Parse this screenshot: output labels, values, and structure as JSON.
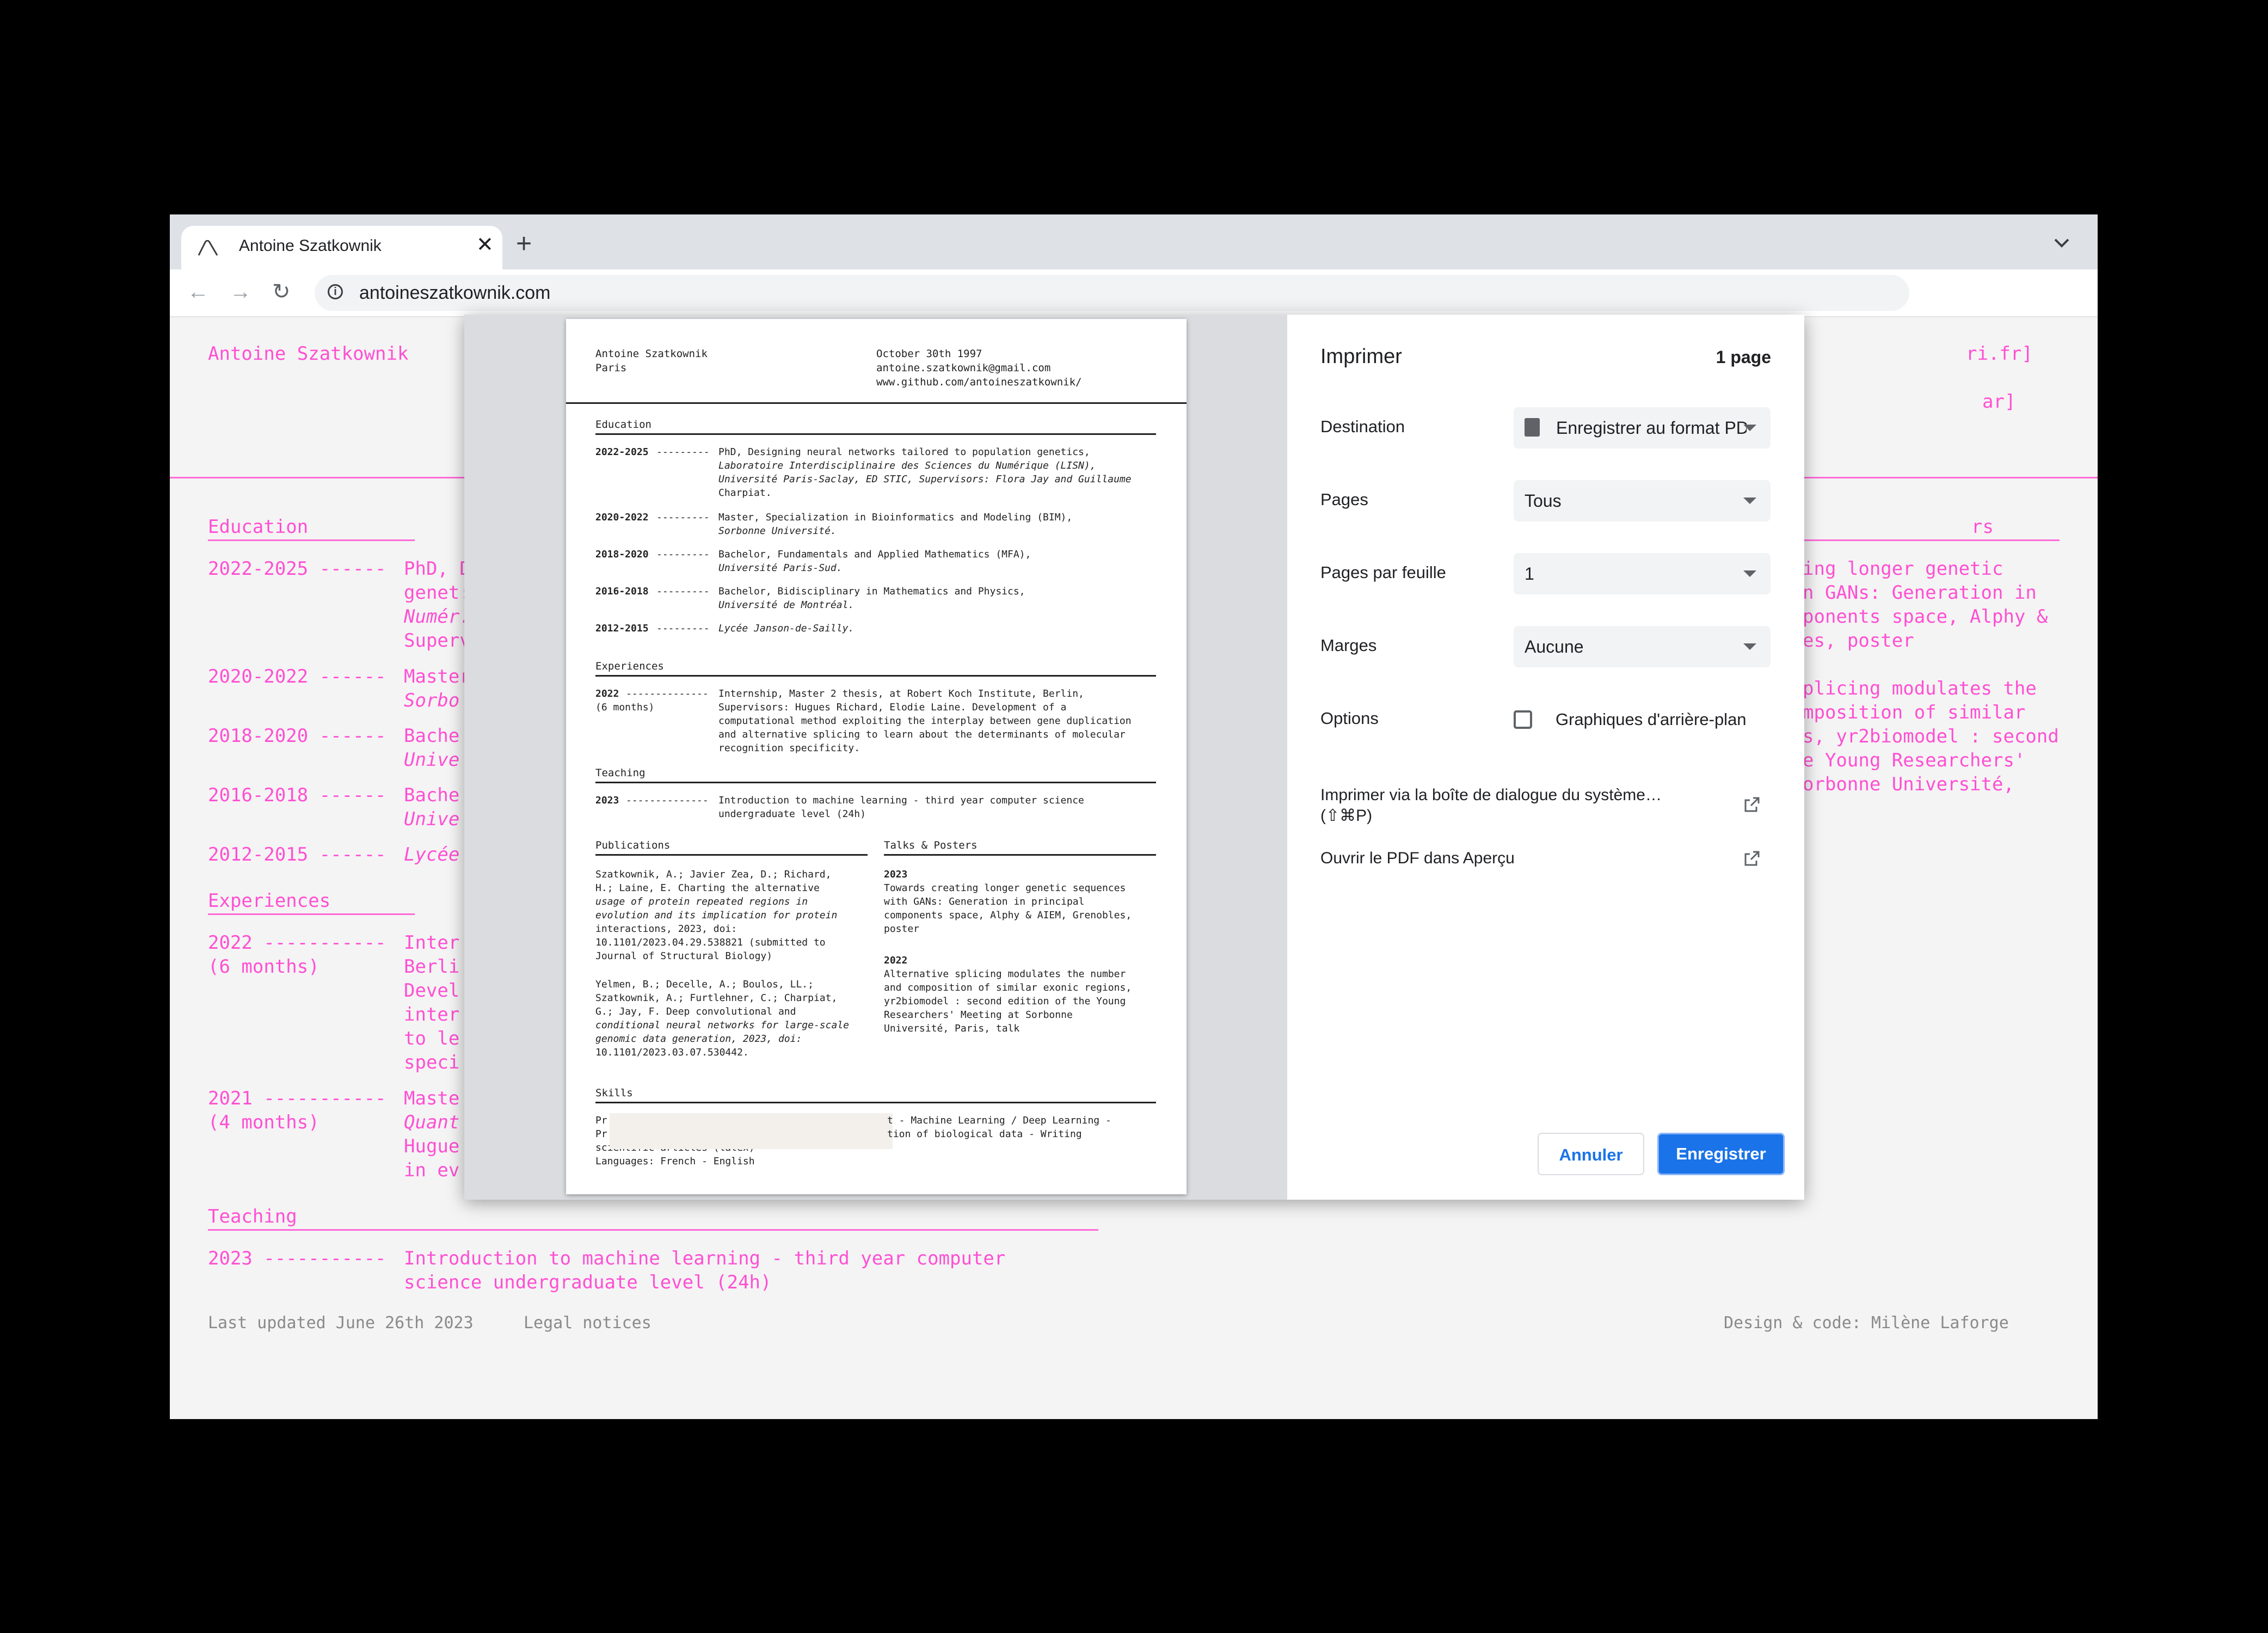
{
  "browser": {
    "tab_title": "Antoine Szatkownik",
    "url": "antoineszatkownik.com"
  },
  "site": {
    "name": "Antoine Szatkownik",
    "contact_1": "ri.fr]",
    "contact_2": "ar]",
    "sections": {
      "education": "Education",
      "experiences": "Experiences",
      "teaching": "Teaching",
      "talks": "rs"
    },
    "education": [
      {
        "years": "2022-2025 ------",
        "text": "PhD, D"
      },
      {
        "years": "",
        "text": "genet:"
      },
      {
        "years": "",
        "text": "Numér."
      },
      {
        "years": "",
        "text": "Superv"
      },
      {
        "years": "2020-2022 ------",
        "text": "Master"
      },
      {
        "years": "",
        "text": "Sorbo"
      },
      {
        "years": "2018-2020 ------",
        "text": "Bache"
      },
      {
        "years": "",
        "text": "Unive"
      },
      {
        "years": "2016-2018 ------",
        "text": "Bache"
      },
      {
        "years": "",
        "text": "Unive"
      },
      {
        "years": "2012-2015 ------",
        "text": "Lycée"
      }
    ],
    "experiences": [
      {
        "years": "2022 -----------",
        "text": "Inter"
      },
      {
        "years": "(6 months)",
        "text": "Berli"
      },
      {
        "years": "",
        "text": "Devel"
      },
      {
        "years": "",
        "text": "inter"
      },
      {
        "years": "",
        "text": "to le"
      },
      {
        "years": "",
        "text": "speci"
      },
      {
        "years": "2021 -----------",
        "text": "Maste"
      },
      {
        "years": "(4 months)",
        "text": "Quant"
      },
      {
        "years": "",
        "text": "Hugue"
      },
      {
        "years": "",
        "text": "in ev"
      }
    ],
    "teaching": {
      "years": "2023 -----------",
      "line1": "Introduction to machine learning - third year computer",
      "line2": "science undergraduate level (24h)"
    },
    "talks_right": [
      "ing longer genetic",
      "n GANs: Generation in",
      "ponents space, Alphy &",
      "es, poster",
      "",
      "plicing modulates the",
      "mposition of similar",
      "s, yr2biomodel : second",
      "e Young Researchers'",
      "orbonne Université,"
    ],
    "footer": {
      "updated": "Last updated June 26th 2023",
      "legal": "Legal notices",
      "credit": "Design & code: Milène Laforge"
    }
  },
  "resume": {
    "name": "Antoine Szatkownik",
    "city": "Paris",
    "date": "October 30th 1997",
    "email": "antoine.szatkownik@gmail.com",
    "github": "www.github.com/antoineszatkownik/",
    "education_title": "Education",
    "edu": [
      {
        "years": "2022-2025",
        "dash": "---------",
        "l1": "PhD, Designing neural networks tailored to population genetics,",
        "l2": "Laboratoire Interdisciplinaire des Sciences du Numérique (LISN),",
        "l3": "Université Paris-Saclay, ED STIC, Supervisors: Flora Jay and Guillaume",
        "l4": "Charpiat."
      },
      {
        "years": "2020-2022",
        "dash": "---------",
        "l1": "Master, Specialization in Bioinformatics and Modeling (BIM),",
        "l2": "Sorbonne Université."
      },
      {
        "years": "2018-2020",
        "dash": "---------",
        "l1": "Bachelor, Fundamentals and Applied Mathematics (MFA),",
        "l2": "Université Paris-Sud."
      },
      {
        "years": "2016-2018",
        "dash": "---------",
        "l1": "Bachelor, Bidisciplinary in Mathematics and Physics,",
        "l2": "Université de Montréal."
      },
      {
        "years": "2012-2015",
        "dash": "---------",
        "l1": "Lycée Janson-de-Sailly."
      }
    ],
    "experiences_title": "Experiences",
    "exp": {
      "years": "2022",
      "dash": "--------------",
      "duration": "(6 months)",
      "l1": "Internship, Master 2 thesis, at Robert Koch Institute, Berlin,",
      "l2": "Supervisors: Hugues Richard, Elodie Laine. Development of a",
      "l3": "computational method exploiting the interplay between gene duplication",
      "l4": "and alternative splicing to learn about the determinants of molecular",
      "l5": "recognition specificity."
    },
    "teaching_title": "Teaching",
    "teach": {
      "years": "2023",
      "dash": "--------------",
      "l1": "Introduction to machine learning - third year computer science",
      "l2": "undergraduate level (24h)"
    },
    "publications_title": "Publications",
    "pubs": [
      "Szatkownik, A.; Javier Zea, D.; Richard,",
      "H.; Laine, E. Charting the alternative",
      "usage of protein repeated regions in",
      "evolution and its implication for protein",
      "interactions, 2023, doi:",
      "10.1101/2023.04.29.538821 (submitted to",
      "Journal of Structural Biology)",
      "",
      "Yelmen, B.; Decelle, A.; Boulos, LL.;",
      "Szatkownik, A.; Furtlehner, C.; Charpiat,",
      "G.; Jay, F. Deep convolutional and",
      "conditional neural networks for large-scale",
      "genomic data generation, 2023, doi:",
      "10.1101/2023.03.07.530442."
    ],
    "talks_title": "Talks & Posters",
    "talks": [
      "2023",
      "Towards creating longer genetic sequences",
      "with GANs: Generation in principal",
      "components space, Alphy & AIEM, Grenobles,",
      "poster",
      "",
      "2022",
      "Alternative splicing modulates the number",
      "and composition of similar exonic regions,",
      "yr2biomodel : second edition of the Young",
      "Researchers' Meeting at Sorbonne",
      "Université, Paris, talk"
    ],
    "skills_title": "Skills",
    "skills": [
      "Pr",
      "Pr",
      "scientific articles (latex)",
      "Languages: French - English"
    ],
    "skills_right": [
      "t - Machine Learning / Deep Learning -",
      "tion of biological data - Writing"
    ]
  },
  "print": {
    "title": "Imprimer",
    "page_count": "1 page",
    "destination_label": "Destination",
    "destination_value": "Enregistrer au format PDF",
    "pages_label": "Pages",
    "pages_value": "Tous",
    "per_sheet_label": "Pages par feuille",
    "per_sheet_value": "1",
    "margins_label": "Marges",
    "margins_value": "Aucune",
    "options_label": "Options",
    "background_graphics": "Graphiques d'arrière-plan",
    "background_graphics_checked": false,
    "system_dialog_line1": "Imprimer via la boîte de dialogue du système…",
    "system_dialog_line2": "(⇧⌘P)",
    "open_preview": "Ouvrir le PDF dans Aperçu",
    "cancel": "Annuler",
    "save": "Enregistrer"
  }
}
